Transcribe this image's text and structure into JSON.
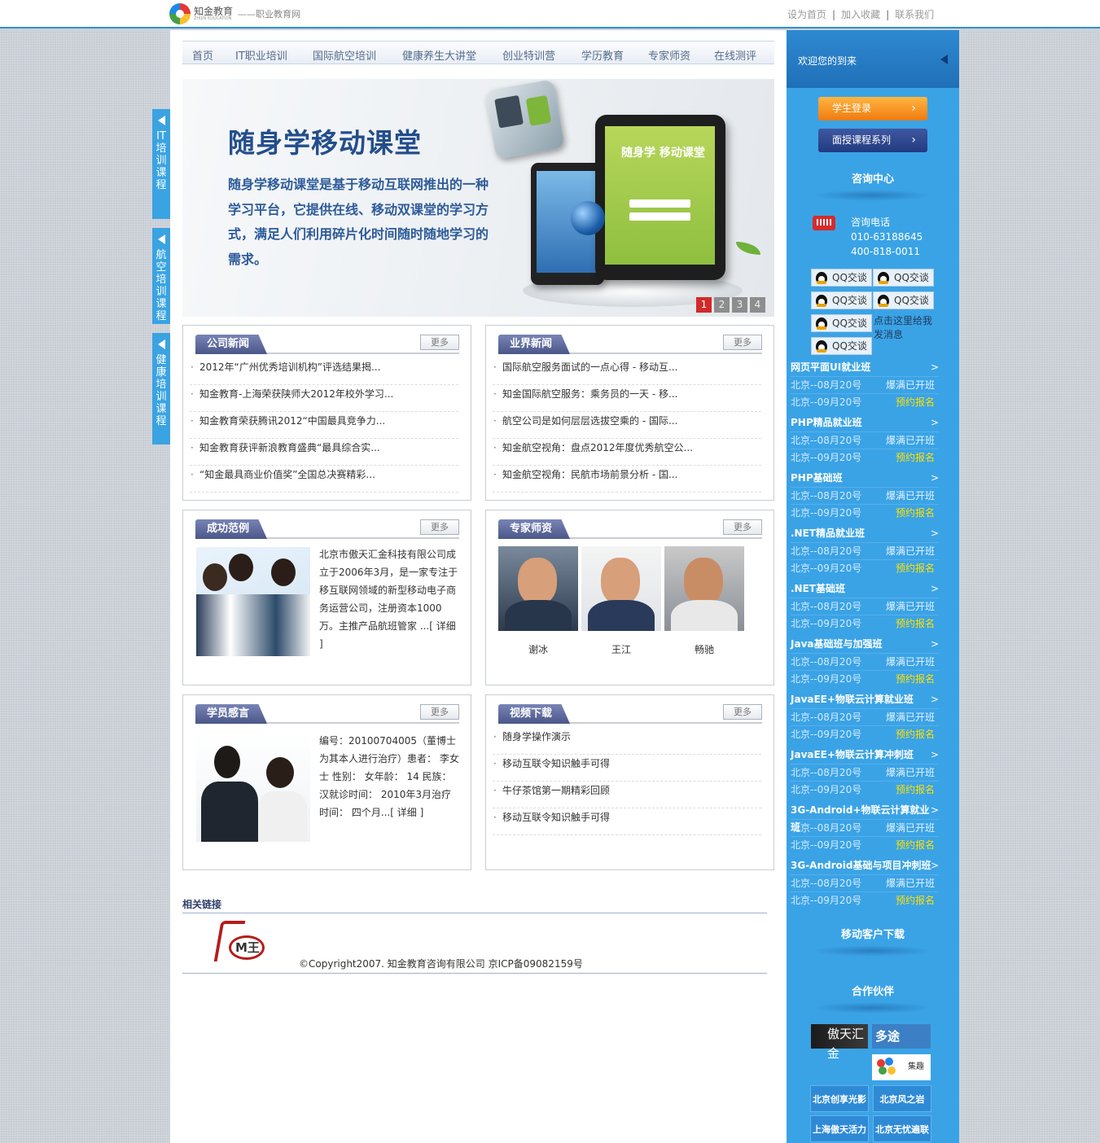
{
  "header": {
    "brand": "知金教育",
    "brand_en": "ZHIJIN EDUCATION",
    "slogan": "——职业教育网",
    "links": [
      "设为首页",
      "加入收藏",
      "联系我们"
    ],
    "separator": "|"
  },
  "nav": {
    "items": [
      "首页",
      "IT职业培训",
      "国际航空培训",
      "健康养生大讲堂",
      "创业特训营",
      "学历教育",
      "专家师资",
      "在线测评"
    ]
  },
  "banner": {
    "title": "随身学移动课堂",
    "description": "随身学移动课堂是基于移动互联网推出的一种学习平台，它提供在线、移动双课堂的学习方式，满足人们利用碎片化时间随时随地学习的需求。",
    "tablet_text": "随身学 移动课堂",
    "pages": [
      "1",
      "2",
      "3",
      "4"
    ],
    "active_page": "1"
  },
  "float_tabs": [
    "IT培训课程",
    "航空培训课程",
    "健康培训课程"
  ],
  "more_label": "更多",
  "company_news": {
    "title": "公司新闻",
    "items": [
      "2012年“广州优秀培训机构”评选结果揭...",
      "知金教育-上海荣获陕师大2012年校外学习...",
      "知金教育荣获腾讯2012“中国最具竞争力...",
      "知金教育获评新浪教育盛典“最具综合实...",
      "“知金最具商业价值奖”全国总决赛精彩..."
    ]
  },
  "industry_news": {
    "title": "业界新闻",
    "items": [
      "国际航空服务面试的一点心得 - 移动互...",
      "知金国际航空服务：乘务员的一天 - 移...",
      "航空公司是如何层层选拔空乘的 - 国际...",
      "知金航空视角：盘点2012年度优秀航空公...",
      "知金航空视角：民航市场前景分析 - 国..."
    ]
  },
  "success_cases": {
    "title": "成功范例",
    "text": "北京市傲天汇金科技有限公司成立于2006年3月，是一家专注于移互联网领域的新型移动电子商务运营公司，注册资本1000万。主推产品航班管家",
    "detail": "...[ 详细 ]"
  },
  "experts": {
    "title": "专家师资",
    "names": [
      "谢冰",
      "王江",
      "畅驰"
    ]
  },
  "testimonials": {
    "title": "学员感言",
    "text": "编号：20100704005（董博士为其本人进行治疗）患者： 李女士 性别： 女年龄： 14 民族： 汉就诊时间： 2010年3月治疗时间： 四个月",
    "detail": "...[ 详细 ]"
  },
  "videos": {
    "title": "视频下载",
    "items": [
      "随身学操作演示",
      "移动互联令知识触手可得",
      "牛仔茶馆第一期精彩回顾",
      "移动互联令知识触手可得"
    ]
  },
  "footer": {
    "links_title": "相关链接",
    "logo_text": "M王",
    "copyright": "©Copyright2007. 知金教育咨询有限公司 京ICP备09082159号"
  },
  "sidebar": {
    "welcome": "欢迎您的到来",
    "student_login": "学生登录",
    "course_series": "面授课程系列",
    "consult_title": "咨询中心",
    "phone_label": "咨询电话",
    "phones": [
      "010-63188645",
      "400-818-0011"
    ],
    "qq_label": "QQ交谈",
    "qq_note": "点击这里给我发消息",
    "courses": [
      {
        "name": "网页平面UI就业班",
        "rows": [
          [
            "北京--08月20号",
            "爆满已开班"
          ],
          [
            "北京--09月20号",
            "预约报名"
          ]
        ]
      },
      {
        "name": "PHP精品就业班",
        "rows": [
          [
            "北京--08月20号",
            "爆满已开班"
          ],
          [
            "北京--09月20号",
            "预约报名"
          ]
        ]
      },
      {
        "name": "PHP基础班",
        "rows": [
          [
            "北京--08月20号",
            "爆满已开班"
          ],
          [
            "北京--09月20号",
            "预约报名"
          ]
        ]
      },
      {
        "name": ".NET精品就业班",
        "rows": [
          [
            "北京--08月20号",
            "爆满已开班"
          ],
          [
            "北京--09月20号",
            "预约报名"
          ]
        ]
      },
      {
        "name": ".NET基础班",
        "rows": [
          [
            "北京--08月20号",
            "爆满已开班"
          ],
          [
            "北京--09月20号",
            "预约报名"
          ]
        ]
      },
      {
        "name": "Java基础班与加强班",
        "rows": [
          [
            "北京--08月20号",
            "爆满已开班"
          ],
          [
            "北京--09月20号",
            "预约报名"
          ]
        ]
      },
      {
        "name": "JavaEE+物联云计算就业班",
        "rows": [
          [
            "北京--08月20号",
            "爆满已开班"
          ],
          [
            "北京--09月20号",
            "预约报名"
          ]
        ]
      },
      {
        "name": "JavaEE+物联云计算冲刺班",
        "rows": [
          [
            "北京--08月20号",
            "爆满已开班"
          ],
          [
            "北京--09月20号",
            "预约报名"
          ]
        ]
      },
      {
        "name": "3G-Android+物联云计算就业班",
        "rows": [
          [
            "北京--08月20号",
            "爆满已开班"
          ],
          [
            "北京--09月20号",
            "预约报名"
          ]
        ]
      },
      {
        "name": "3G-Android基础与项目冲刺班",
        "rows": [
          [
            "北京--08月20号",
            "爆满已开班"
          ],
          [
            "北京--09月20号",
            "预约报名"
          ]
        ]
      }
    ],
    "course_arrow": ">",
    "mobile_download": "移动客户下载",
    "partners_title": "合作伙伴",
    "partner_logos": [
      "傲天汇金",
      "多途",
      "集趣"
    ],
    "partner_buttons": [
      "北京创享光影",
      "北京风之岩",
      "上海傲天活力",
      "北京无忧遍联"
    ]
  }
}
